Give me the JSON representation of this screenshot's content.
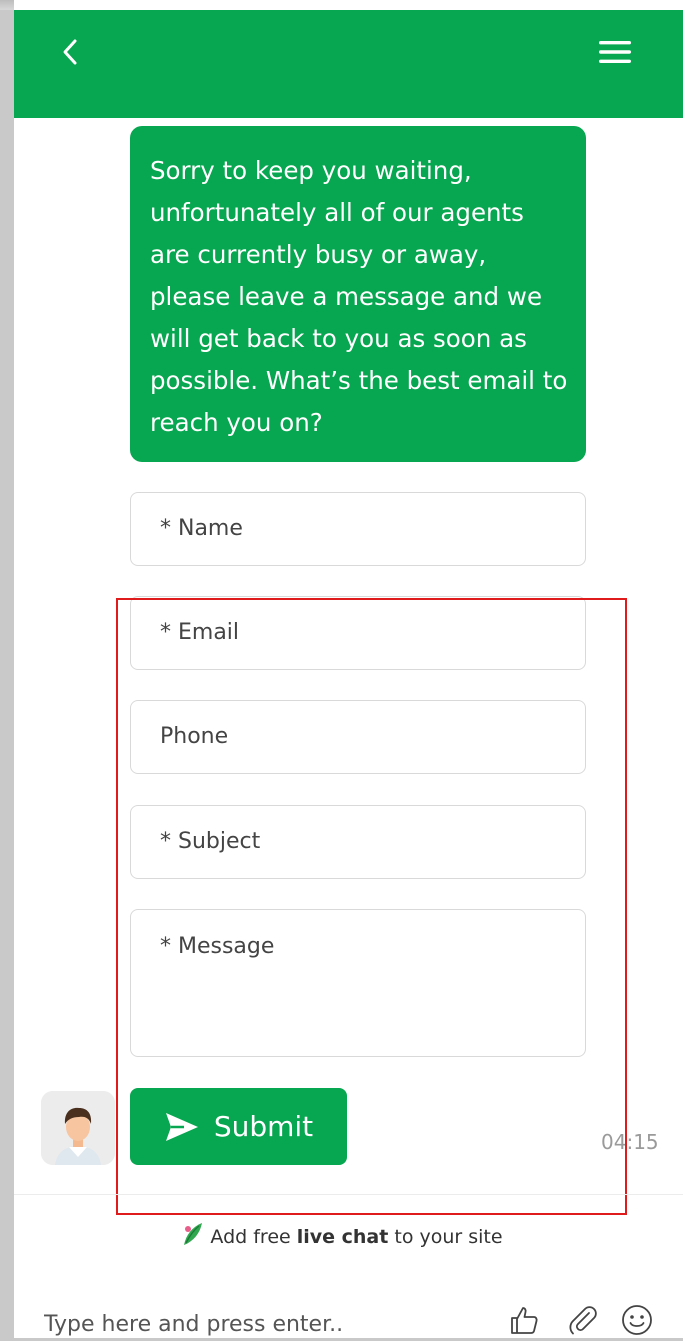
{
  "header": {
    "back_icon": "chevron-left-icon",
    "menu_icon": "hamburger-menu-icon"
  },
  "chat": {
    "message_lines": [
      "Sorry to keep you waiting,",
      "unfortunately all of our agents",
      "are currently busy or away,",
      "please leave a message and we",
      "will get back to you as soon as",
      "possible. What’s the best email to",
      "reach you on?"
    ],
    "timestamp": "04:15"
  },
  "form": {
    "name_placeholder": "* Name",
    "email_placeholder": "* Email",
    "phone_placeholder": "Phone",
    "subject_placeholder": "* Subject",
    "message_placeholder": "* Message",
    "submit_label": "Submit"
  },
  "branding": {
    "prefix": "Add free ",
    "bold": "live chat",
    "suffix": " to your site"
  },
  "composer": {
    "placeholder": "Type here and press enter..",
    "icons": [
      "thumbs-up-icon",
      "paperclip-icon",
      "smiley-icon"
    ]
  },
  "colors": {
    "brand_green": "#07a650",
    "highlight_red": "#e01b1b"
  }
}
